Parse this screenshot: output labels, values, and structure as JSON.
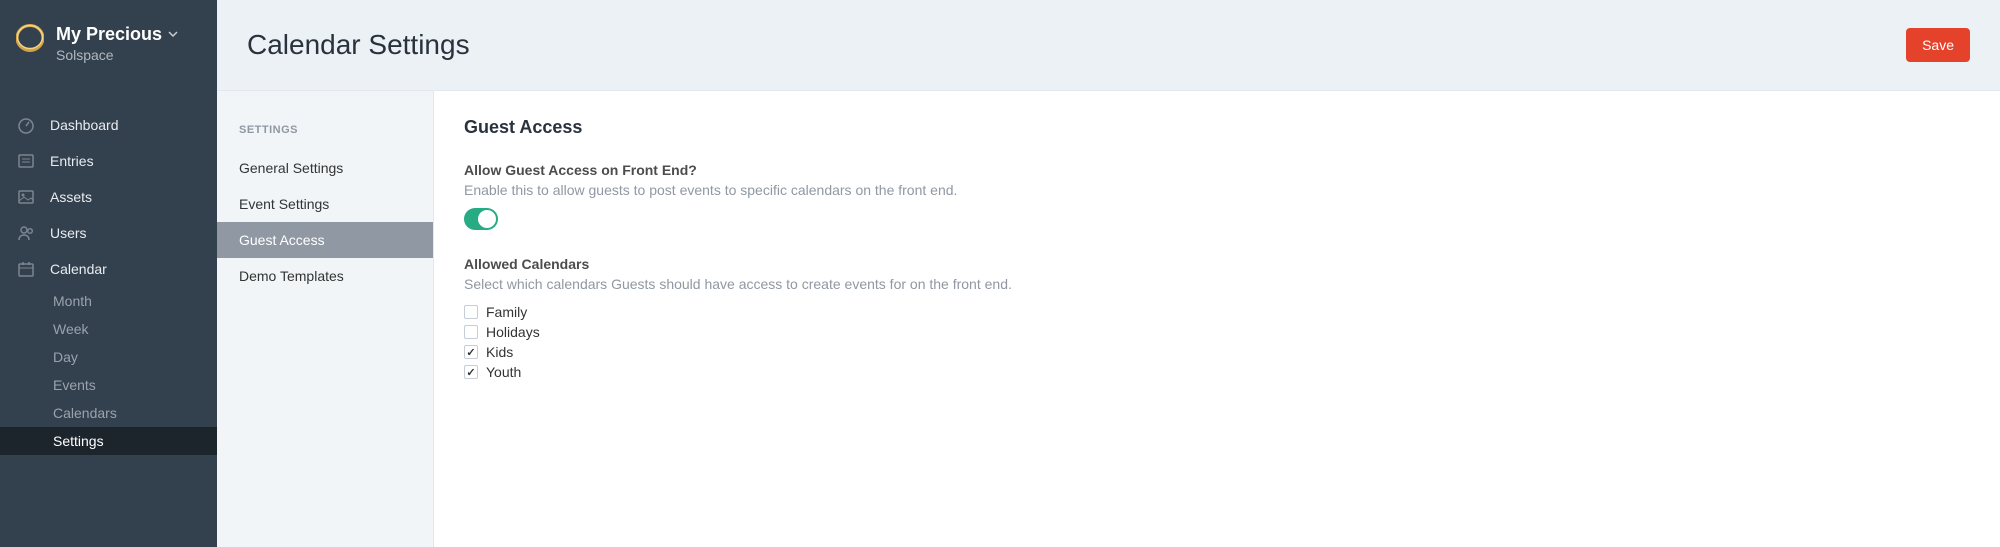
{
  "brand": {
    "title": "My Precious",
    "subtitle": "Solspace"
  },
  "primary_nav": {
    "dashboard": "Dashboard",
    "entries": "Entries",
    "assets": "Assets",
    "users": "Users",
    "calendar": "Calendar"
  },
  "calendar_subnav": {
    "month": "Month",
    "week": "Week",
    "day": "Day",
    "events": "Events",
    "calendars": "Calendars",
    "settings": "Settings"
  },
  "page": {
    "title": "Calendar Settings",
    "save": "Save"
  },
  "settings_sidebar": {
    "heading": "SETTINGS",
    "general": "General Settings",
    "event": "Event Settings",
    "guest": "Guest Access",
    "demo": "Demo Templates"
  },
  "content": {
    "section_title": "Guest Access",
    "allow_guest": {
      "label": "Allow Guest Access on Front End?",
      "desc": "Enable this to allow guests to post events to specific calendars on the front end.",
      "enabled": true
    },
    "allowed_calendars": {
      "label": "Allowed Calendars",
      "desc": "Select which calendars Guests should have access to create events for on the front end.",
      "options": [
        {
          "label": "Family",
          "checked": false
        },
        {
          "label": "Holidays",
          "checked": false
        },
        {
          "label": "Kids",
          "checked": true
        },
        {
          "label": "Youth",
          "checked": true
        }
      ]
    }
  }
}
